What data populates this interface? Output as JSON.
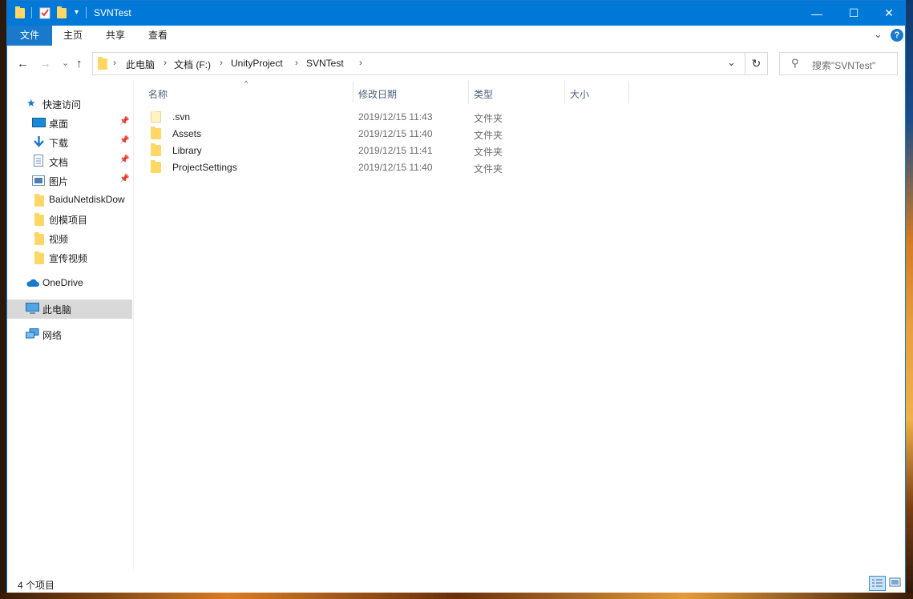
{
  "window": {
    "title": "SVNTest"
  },
  "titlebar": {
    "minimize": "—",
    "maximize": "☐",
    "close": "✕"
  },
  "ribbon": {
    "tabs": [
      "文件",
      "主页",
      "共享",
      "查看"
    ],
    "expand": "⌄",
    "help": "?"
  },
  "nav_buttons": {
    "back": "←",
    "forward": "→",
    "recent": "⌄",
    "up": "↑"
  },
  "address": {
    "crumbs": [
      "此电脑",
      "文档 (F:)",
      "UnityProject",
      "SVNTest"
    ],
    "separator": "›",
    "dropdown": "⌄",
    "refresh": "↻"
  },
  "search": {
    "placeholder": "搜索\"SVNTest\"",
    "icon": "⚲"
  },
  "sidebar": {
    "quick_access": {
      "label": "快速访问",
      "icon": "star-icon"
    },
    "items": [
      {
        "label": "桌面",
        "icon": "desktop-icon",
        "pinned": true
      },
      {
        "label": "下载",
        "icon": "download-icon",
        "pinned": true
      },
      {
        "label": "文档",
        "icon": "document-icon",
        "pinned": true
      },
      {
        "label": "图片",
        "icon": "picture-icon",
        "pinned": true
      },
      {
        "label": "BaiduNetdiskDow",
        "icon": "folder-icon",
        "pinned": false
      },
      {
        "label": "创模项目",
        "icon": "folder-icon",
        "pinned": false
      },
      {
        "label": "视频",
        "icon": "folder-icon",
        "pinned": false
      },
      {
        "label": "宣传视频",
        "icon": "folder-icon",
        "pinned": false
      }
    ],
    "onedrive": {
      "label": "OneDrive",
      "icon": "cloud-icon"
    },
    "this_pc": {
      "label": "此电脑",
      "icon": "computer-icon"
    },
    "network": {
      "label": "网络",
      "icon": "network-icon"
    },
    "pin_glyph": "📌"
  },
  "columns": {
    "name": "名称",
    "date": "修改日期",
    "type": "类型",
    "size": "大小"
  },
  "files": [
    {
      "name": ".svn",
      "date": "2019/12/15 11:43",
      "type": "文件夹",
      "hidden": true
    },
    {
      "name": "Assets",
      "date": "2019/12/15 11:40",
      "type": "文件夹",
      "hidden": false
    },
    {
      "name": "Library",
      "date": "2019/12/15 11:41",
      "type": "文件夹",
      "hidden": false
    },
    {
      "name": "ProjectSettings",
      "date": "2019/12/15 11:40",
      "type": "文件夹",
      "hidden": false
    }
  ],
  "status": {
    "item_count": "4 个项目"
  },
  "colors": {
    "accent": "#0078d7",
    "folder": "#ffd766",
    "selected": "#d9d9d9"
  }
}
